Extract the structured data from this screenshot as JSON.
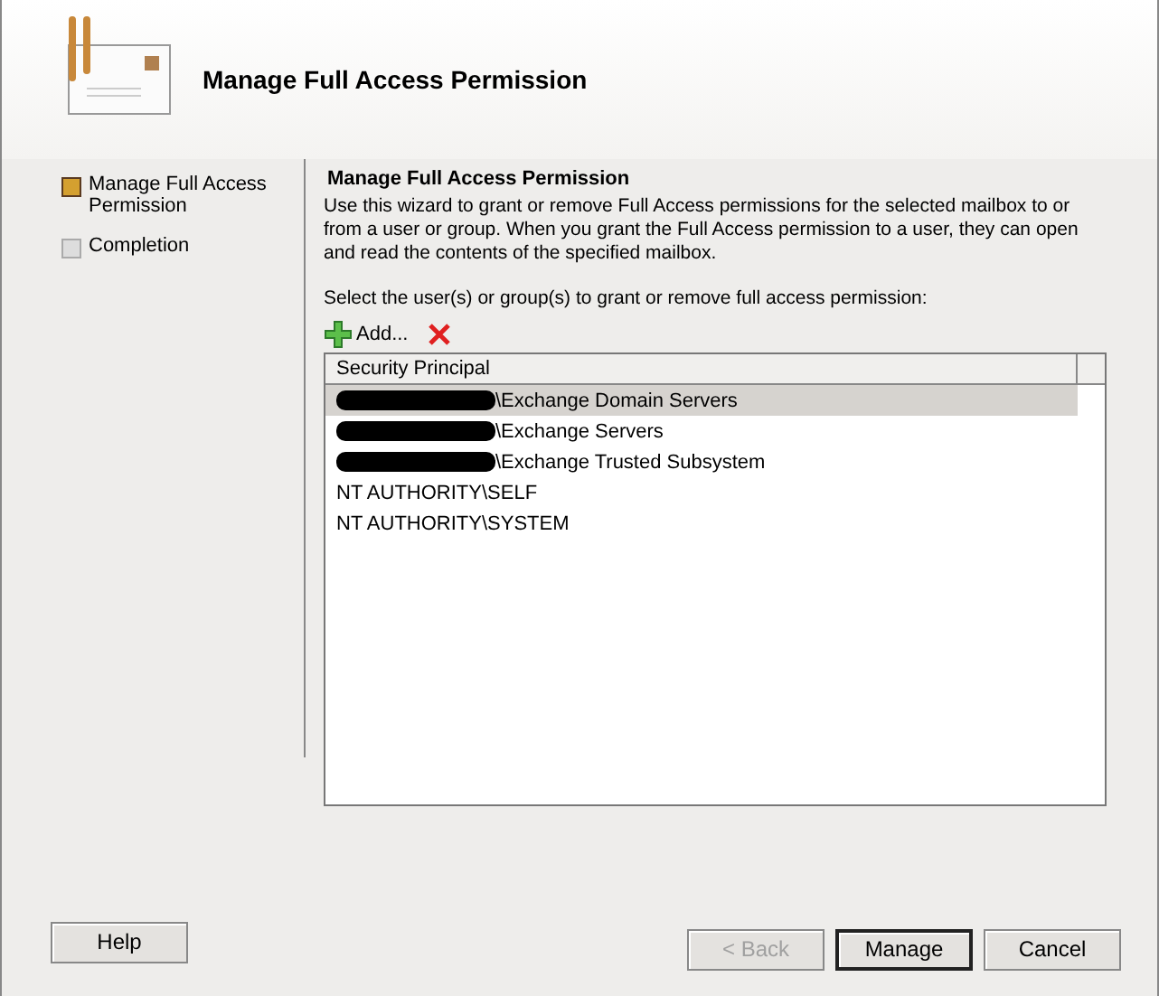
{
  "window": {
    "title": "Manage Full Access Permission"
  },
  "steps": [
    {
      "label": "Manage Full Access Permission",
      "selected": true
    },
    {
      "label": "Completion",
      "selected": false
    }
  ],
  "page": {
    "heading": "Manage Full Access Permission",
    "description": "Use this wizard to grant or remove Full Access permissions for the selected mailbox to or from a user or group. When you grant the Full Access permission to a user, they can open and read the contents of the specified mailbox.",
    "prompt": "Select the user(s) or group(s) to grant or remove full access permission:",
    "add_label": "Add..."
  },
  "table": {
    "columns": [
      "Security Principal"
    ],
    "rows": [
      {
        "text": "\\Exchange Domain Servers",
        "redacted": true,
        "selected": true
      },
      {
        "text": "\\Exchange Servers",
        "redacted": true,
        "selected": false
      },
      {
        "text": "\\Exchange Trusted Subsystem",
        "redacted": true,
        "selected": false
      },
      {
        "text": "NT AUTHORITY\\SELF",
        "redacted": false,
        "selected": false
      },
      {
        "text": "NT AUTHORITY\\SYSTEM",
        "redacted": false,
        "selected": false
      }
    ]
  },
  "buttons": [
    {
      "label": "Help",
      "kind": "help",
      "disabled": false
    },
    {
      "label": "< Back",
      "kind": "nav",
      "disabled": true
    },
    {
      "label": "Manage",
      "kind": "default",
      "disabled": false
    },
    {
      "label": "Cancel",
      "kind": "nav",
      "disabled": false
    }
  ]
}
